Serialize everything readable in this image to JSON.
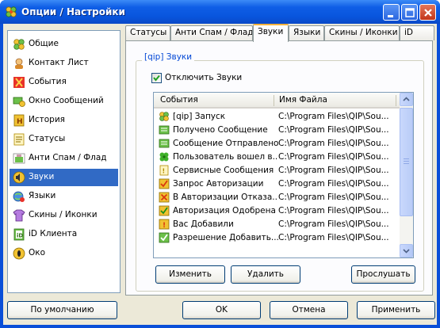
{
  "window": {
    "title": "Опции / Настройки"
  },
  "colors": {
    "titlebar": "#0855dd",
    "selection": "#316ac5",
    "group_title": "#0046d5",
    "face": "#ece9d8"
  },
  "nav": {
    "items": [
      {
        "label": "Общие",
        "icon": "general-icon"
      },
      {
        "label": "Контакт Лист",
        "icon": "contact-list-icon"
      },
      {
        "label": "События",
        "icon": "events-icon"
      },
      {
        "label": "Окно Сообщений",
        "icon": "message-window-icon"
      },
      {
        "label": "История",
        "icon": "history-icon"
      },
      {
        "label": "Статусы",
        "icon": "statuses-icon"
      },
      {
        "label": "Анти Спам / Флад",
        "icon": "antispam-icon"
      },
      {
        "label": "Звуки",
        "icon": "sounds-icon",
        "selected": true
      },
      {
        "label": "Языки",
        "icon": "languages-icon"
      },
      {
        "label": "Скины / Иконки",
        "icon": "skins-icon"
      },
      {
        "label": "iD Клиента",
        "icon": "client-id-icon"
      },
      {
        "label": "Око",
        "icon": "eye-icon"
      }
    ]
  },
  "tabs": [
    {
      "label": "Статусы"
    },
    {
      "label": "Анти Спам / Флад"
    },
    {
      "label": "Звуки",
      "active": true
    },
    {
      "label": "Языки"
    },
    {
      "label": "Скины / Иконки"
    },
    {
      "label": "iD"
    }
  ],
  "panel": {
    "group_title": "[qip] Звуки",
    "disable_sounds": {
      "label": "Отключить Звуки",
      "checked": true
    },
    "list": {
      "col_events": "События",
      "col_filename": "Имя Файла",
      "rows": [
        {
          "event": "[qip] Запуск",
          "file": "C:\\Program Files\\QIP\\Sou...",
          "icon": "qip-flower-icon"
        },
        {
          "event": "Получено Сообщение",
          "file": "C:\\Program Files\\QIP\\Sou...",
          "icon": "message-icon"
        },
        {
          "event": "Сообщение Отправлено",
          "file": "C:\\Program Files\\QIP\\Sou...",
          "icon": "message-sent-icon"
        },
        {
          "event": "Пользователь вошел в...",
          "file": "C:\\Program Files\\QIP\\Sou...",
          "icon": "user-online-icon"
        },
        {
          "event": "Сервисные Сообщения",
          "file": "C:\\Program Files\\QIP\\Sou...",
          "icon": "service-message-icon"
        },
        {
          "event": "Запрос Авторизации",
          "file": "C:\\Program Files\\QIP\\Sou...",
          "icon": "auth-request-icon"
        },
        {
          "event": "В Авторизации Отказа...",
          "file": "C:\\Program Files\\QIP\\Sou...",
          "icon": "auth-denied-icon"
        },
        {
          "event": "Авторизация Одобрена",
          "file": "C:\\Program Files\\QIP\\Sou...",
          "icon": "auth-approved-icon"
        },
        {
          "event": "Вас Добавили",
          "file": "C:\\Program Files\\QIP\\Sou...",
          "icon": "you-added-icon"
        },
        {
          "event": "Разрешение Добавить...",
          "file": "C:\\Program Files\\QIP\\Sou...",
          "icon": "add-permission-icon"
        }
      ]
    },
    "buttons": {
      "change": "Изменить",
      "delete": "Удалить",
      "listen": "Прослушать"
    }
  },
  "footer": {
    "default": "По умолчанию",
    "ok": "OK",
    "cancel": "Отмена",
    "apply": "Применить"
  }
}
